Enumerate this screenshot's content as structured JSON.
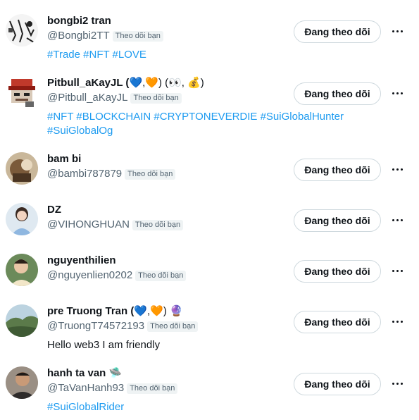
{
  "rows": [
    {
      "name": "bongbi2 tran",
      "name_emoji": "",
      "handle": "@Bongbi2TT",
      "badge": "Theo dõi bạn",
      "bio_lines": [
        "#Trade #NFT #LOVE"
      ],
      "follow_label": "Đang theo dõi"
    },
    {
      "name": "Pitbull_aKayJL (",
      "name_emoji": "💙,🧡) (👀, 💰)",
      "handle": "@Pitbull_aKayJL",
      "badge": "Theo dõi bạn",
      "bio_lines": [
        "#NFT #BLOCKCHAIN #CRYPTONEVERDIE #SuiGlobalHunter",
        "#SuiGlobalOg"
      ],
      "follow_label": "Đang theo dõi"
    },
    {
      "name": "bam bi",
      "name_emoji": "",
      "handle": "@bambi787879",
      "badge": "Theo dõi bạn",
      "bio_lines": [],
      "follow_label": "Đang theo dõi"
    },
    {
      "name": "DZ",
      "name_emoji": "",
      "handle": "@VIHONGHUAN",
      "badge": "Theo dõi bạn",
      "bio_lines": [],
      "follow_label": "Đang theo dõi"
    },
    {
      "name": "nguyenthilien",
      "name_emoji": "",
      "handle": "@nguyenlien0202",
      "badge": "Theo dõi bạn",
      "bio_lines": [],
      "follow_label": "Đang theo dõi"
    },
    {
      "name": "pre Truong Tran (",
      "name_emoji": "💙,🧡) 🔮",
      "handle": "@TruongT74572193",
      "badge": "Theo dõi bạn",
      "bio_lines": [
        "Hello web3 I am friendly"
      ],
      "follow_label": "Đang theo dõi"
    },
    {
      "name": "hanh ta van",
      "name_emoji": "🛸",
      "handle": "@TaVanHanh93",
      "badge": "Theo dõi bạn",
      "bio_lines": [
        "#SuiGlobalRider"
      ],
      "follow_label": "Đang theo dõi"
    }
  ],
  "colors": {
    "link": "#1d9bf0",
    "secondary": "#536471",
    "border": "#cfd9de"
  }
}
